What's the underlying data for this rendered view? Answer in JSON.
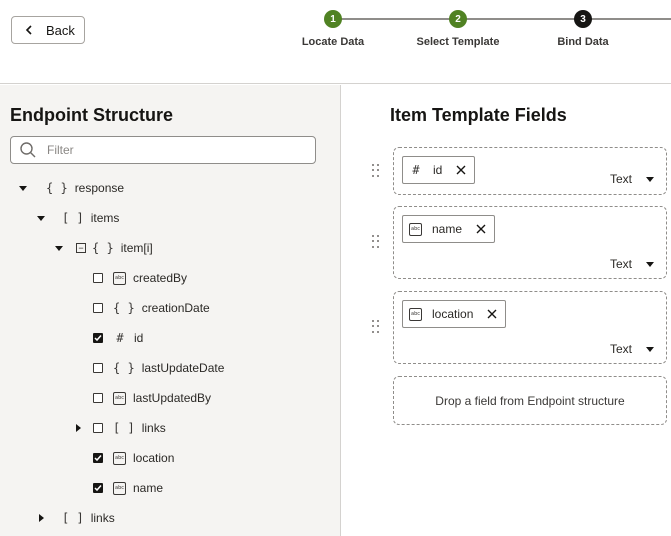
{
  "header": {
    "back_label": "Back",
    "steps": [
      {
        "number": "1",
        "label": "Locate Data",
        "state": "done"
      },
      {
        "number": "2",
        "label": "Select Template",
        "state": "done"
      },
      {
        "number": "3",
        "label": "Bind Data",
        "state": "current"
      }
    ],
    "colors": {
      "done": "#508223",
      "current": "#161513"
    }
  },
  "left_panel": {
    "title": "Endpoint Structure",
    "filter_placeholder": "Filter",
    "tree": [
      {
        "label": "response",
        "icon": "object-braces-icon",
        "glyph": "{ }",
        "caret": "expanded",
        "checkbox": null
      },
      {
        "label": "items",
        "icon": "array-brackets-icon",
        "glyph": "[ ]",
        "caret": "expanded",
        "checkbox": null
      },
      {
        "label": "item[i]",
        "icon": "object-braces-icon",
        "glyph": "{ }",
        "caret": "expanded",
        "checkbox": "partial"
      },
      {
        "label": "createdBy",
        "icon": "string-abc-icon",
        "glyph": "abc",
        "caret": null,
        "checkbox": false
      },
      {
        "label": "creationDate",
        "icon": "object-braces-icon",
        "glyph": "{ }",
        "caret": null,
        "checkbox": false
      },
      {
        "label": "id",
        "icon": "number-hash-icon",
        "glyph": "#",
        "caret": null,
        "checkbox": true
      },
      {
        "label": "lastUpdateDate",
        "icon": "object-braces-icon",
        "glyph": "{ }",
        "caret": null,
        "checkbox": false
      },
      {
        "label": "lastUpdatedBy",
        "icon": "string-abc-icon",
        "glyph": "abc",
        "caret": null,
        "checkbox": false
      },
      {
        "label": "links",
        "icon": "array-brackets-icon",
        "glyph": "[ ]",
        "caret": "collapsed",
        "checkbox": false
      },
      {
        "label": "location",
        "icon": "string-abc-icon",
        "glyph": "abc",
        "caret": null,
        "checkbox": true
      },
      {
        "label": "name",
        "icon": "string-abc-icon",
        "glyph": "abc",
        "caret": null,
        "checkbox": true
      },
      {
        "label": "links",
        "icon": "array-brackets-icon",
        "glyph": "[ ]",
        "caret": "collapsed",
        "checkbox": null
      }
    ]
  },
  "right_panel": {
    "title": "Item Template Fields",
    "fields": [
      {
        "name": "id",
        "icon": "number-hash-icon",
        "glyph": "#",
        "type": "Text"
      },
      {
        "name": "name",
        "icon": "string-abc-icon",
        "glyph": "abc",
        "type": "Text"
      },
      {
        "name": "location",
        "icon": "string-abc-icon",
        "glyph": "abc",
        "type": "Text"
      }
    ],
    "drop_zone_text": "Drop a field from Endpoint structure"
  }
}
